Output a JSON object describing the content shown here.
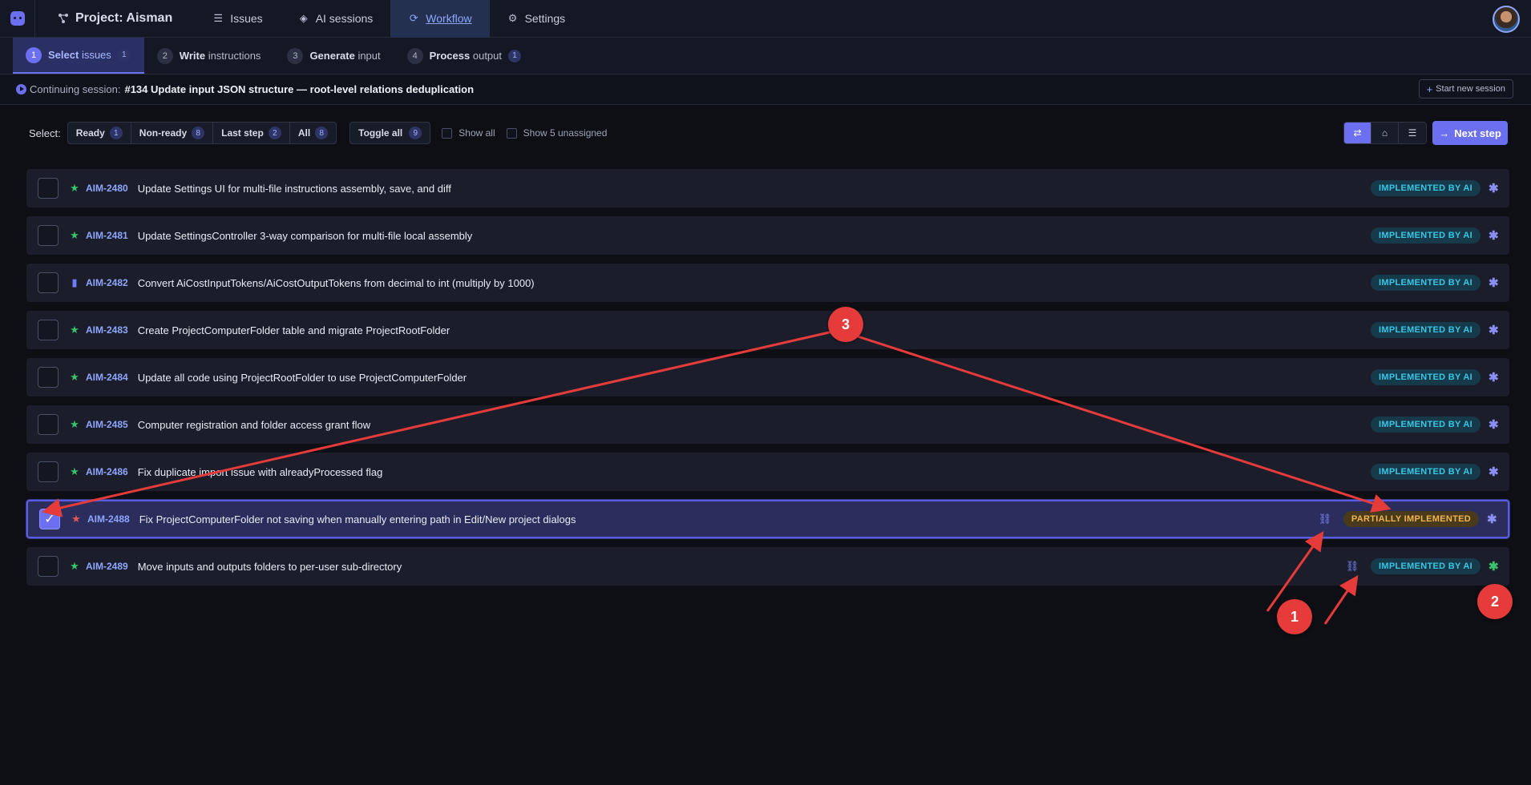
{
  "nav": {
    "project_label": "Project: Aisman",
    "items": [
      {
        "label": "Issues",
        "icon": "list-check-icon"
      },
      {
        "label": "AI sessions",
        "icon": "layers-icon"
      },
      {
        "label": "Workflow",
        "icon": "cycle-icon",
        "active": true
      },
      {
        "label": "Settings",
        "icon": "gear-icon"
      }
    ]
  },
  "steps": [
    {
      "num": "1",
      "bold": "Select",
      "rest": "issues",
      "count": "1",
      "active": true
    },
    {
      "num": "2",
      "bold": "Write",
      "rest": "instructions",
      "count": ""
    },
    {
      "num": "3",
      "bold": "Generate",
      "rest": "input",
      "count": ""
    },
    {
      "num": "4",
      "bold": "Process",
      "rest": "output",
      "count": "1"
    }
  ],
  "session": {
    "prefix": "Continuing session:",
    "title": "#134 Update input JSON structure — root-level relations deduplication",
    "new_session_label": "Start new session"
  },
  "filters": {
    "select_label": "Select:",
    "segments": [
      {
        "label": "Ready",
        "count": "1"
      },
      {
        "label": "Non-ready",
        "count": "8"
      },
      {
        "label": "Last step",
        "count": "2"
      },
      {
        "label": "All",
        "count": "8"
      }
    ],
    "toggle_all": {
      "label": "Toggle all",
      "count": "9"
    },
    "show_all": "Show all",
    "show_unassigned": "Show 5 unassigned",
    "next_step": "Next step"
  },
  "issues": [
    {
      "key": "AIM-2480",
      "title": "Update Settings UI for multi-file instructions assembly, save, and diff",
      "type": "story",
      "status": "IMPLEMENTED BY AI",
      "checked": false,
      "linked": false,
      "asterisk": "blue"
    },
    {
      "key": "AIM-2481",
      "title": "Update SettingsController 3-way comparison for multi-file local assembly",
      "type": "story",
      "status": "IMPLEMENTED BY AI",
      "checked": false,
      "linked": false,
      "asterisk": "blue"
    },
    {
      "key": "AIM-2482",
      "title": "Convert AiCostInputTokens/AiCostOutputTokens from decimal to int (multiply by 1000)",
      "type": "task",
      "status": "IMPLEMENTED BY AI",
      "checked": false,
      "linked": false,
      "asterisk": "blue"
    },
    {
      "key": "AIM-2483",
      "title": "Create ProjectComputerFolder table and migrate ProjectRootFolder",
      "type": "story",
      "status": "IMPLEMENTED BY AI",
      "checked": false,
      "linked": false,
      "asterisk": "blue"
    },
    {
      "key": "AIM-2484",
      "title": "Update all code using ProjectRootFolder to use ProjectComputerFolder",
      "type": "story",
      "status": "IMPLEMENTED BY AI",
      "checked": false,
      "linked": false,
      "asterisk": "blue"
    },
    {
      "key": "AIM-2485",
      "title": "Computer registration and folder access grant flow",
      "type": "story",
      "status": "IMPLEMENTED BY AI",
      "checked": false,
      "linked": false,
      "asterisk": "blue"
    },
    {
      "key": "AIM-2486",
      "title": "Fix duplicate import issue with alreadyProcessed flag",
      "type": "story",
      "status": "IMPLEMENTED BY AI",
      "checked": false,
      "linked": false,
      "asterisk": "blue"
    },
    {
      "key": "AIM-2488",
      "title": "Fix ProjectComputerFolder not saving when manually entering path in Edit/New project dialogs",
      "type": "bug",
      "status": "PARTIALLY IMPLEMENTED",
      "checked": true,
      "linked": true,
      "asterisk": "blue"
    },
    {
      "key": "AIM-2489",
      "title": "Move inputs and outputs folders to per-user sub-directory",
      "type": "story",
      "status": "IMPLEMENTED BY AI",
      "checked": false,
      "linked": true,
      "asterisk": "green"
    }
  ],
  "annotations": [
    "1",
    "2",
    "3"
  ],
  "colors": {
    "accent": "#6b6ff0",
    "annotation": "#e53b3b",
    "implemented": "#37c6e6",
    "partial": "#f0b44a"
  }
}
